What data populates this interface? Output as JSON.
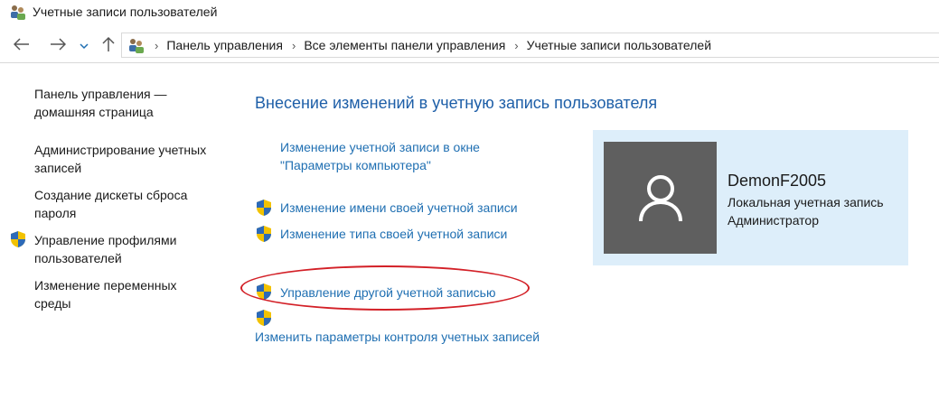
{
  "window": {
    "title": "Учетные записи пользователей",
    "icon": "users-icon"
  },
  "nav": {
    "back_icon": "arrow-left-icon",
    "forward_icon": "arrow-right-icon",
    "recent_icon": "chevron-down-icon",
    "up_icon": "arrow-up-icon"
  },
  "address": {
    "icon": "users-icon",
    "breadcrumbs": [
      "Панель управления",
      "Все элементы панели управления",
      "Учетные записи пользователей"
    ]
  },
  "sidebar": {
    "items": [
      {
        "line1": "Панель управления —",
        "line2": "домашняя страница",
        "shield": false
      },
      {
        "line1": "Администрирование учетных",
        "line2": "записей",
        "shield": false
      },
      {
        "line1": "Создание дискеты сброса",
        "line2": "пароля",
        "shield": false
      },
      {
        "line1": "Управление профилями",
        "line2": "пользователей",
        "shield": true
      },
      {
        "line1": "Изменение переменных",
        "line2": "среды",
        "shield": false
      }
    ]
  },
  "main": {
    "title": "Внесение изменений в учетную запись пользователя",
    "tasks": {
      "pc_settings_line1": "Изменение учетной записи в окне",
      "pc_settings_line2": "\"Параметры компьютера\"",
      "change_name": "Изменение имени своей учетной записи",
      "change_type": "Изменение типа своей учетной записи",
      "manage_other": "Управление другой учетной записью",
      "uac_settings": "Изменить параметры контроля учетных записей"
    }
  },
  "user_card": {
    "name": "DemonF2005",
    "account_type": "Локальная учетная запись",
    "role": "Администратор"
  },
  "colors": {
    "link": "#1f6fb2",
    "heading": "#1e5fa8",
    "card_bg": "#ddeefa",
    "avatar_bg": "#5f5f5f",
    "highlight": "#d32027"
  }
}
